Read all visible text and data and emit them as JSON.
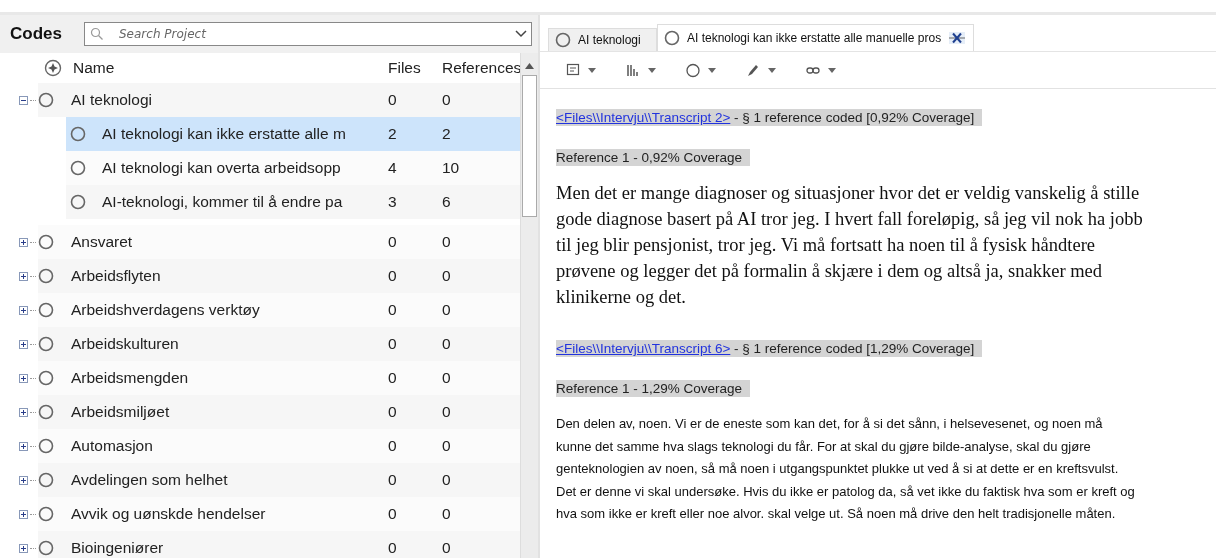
{
  "codes_panel": {
    "title": "Codes",
    "search": {
      "placeholder": "Search Project"
    },
    "columns": [
      "Name",
      "Files",
      "References"
    ],
    "rows": [
      {
        "name": "AI teknologi",
        "files": "0",
        "references": "0",
        "expanded": true,
        "selected": false,
        "children": [
          {
            "name": "AI teknologi kan ikke erstatte alle m",
            "files": "2",
            "references": "2",
            "selected": true
          },
          {
            "name": "AI teknologi kan overta arbeidsopp",
            "files": "4",
            "references": "10",
            "selected": false
          },
          {
            "name": "AI-teknologi, kommer til å endre pa",
            "files": "3",
            "references": "6",
            "selected": false
          }
        ]
      },
      {
        "name": "Ansvaret",
        "files": "0",
        "references": "0",
        "expanded": false,
        "selected": false
      },
      {
        "name": "Arbeidsflyten",
        "files": "0",
        "references": "0",
        "expanded": false,
        "selected": false
      },
      {
        "name": "Arbeidshverdagens verktøy",
        "files": "0",
        "references": "0",
        "expanded": false,
        "selected": false
      },
      {
        "name": "Arbeidskulturen",
        "files": "0",
        "references": "0",
        "expanded": false,
        "selected": false
      },
      {
        "name": "Arbeidsmengden",
        "files": "0",
        "references": "0",
        "expanded": false,
        "selected": false
      },
      {
        "name": "Arbeidsmiljøet",
        "files": "0",
        "references": "0",
        "expanded": false,
        "selected": false
      },
      {
        "name": "Automasjon",
        "files": "0",
        "references": "0",
        "expanded": false,
        "selected": false
      },
      {
        "name": "Avdelingen som helhet",
        "files": "0",
        "references": "0",
        "expanded": false,
        "selected": false
      },
      {
        "name": "Avvik og uønskde hendelser",
        "files": "0",
        "references": "0",
        "expanded": false,
        "selected": false
      },
      {
        "name": "Bioingeniører",
        "files": "0",
        "references": "0",
        "expanded": false,
        "selected": false
      }
    ]
  },
  "tabs": [
    {
      "label": "AI teknologi",
      "selected": false
    },
    {
      "label": "AI teknologi kan ikke erstatte alle manuelle pros",
      "selected": true
    }
  ],
  "references": [
    {
      "link": "<Files\\\\Intervju\\\\Transcript 2>",
      "summary": " - § 1 reference coded  [0,92% Coverage]",
      "reference": "Reference 1 - 0,92% Coverage",
      "kind": "serif",
      "lines": [
        "Men det er mange diagnoser og situasjoner hvor det er veldig vanskelig å stille",
        "gode diagnose basert på AI tror jeg.  I hvert fall foreløpig, så jeg vil nok ha jobb",
        "til jeg blir pensjonist, tror jeg. Vi må fortsatt ha noen til å fysisk håndtere",
        "prøvene og legger det på formalin å skjære i dem og altså ja, snakker med",
        "klinikerne og det."
      ]
    },
    {
      "link": "<Files\\\\Intervju\\\\Transcript 6>",
      "summary": " - § 1 reference coded  [1,29% Coverage]",
      "reference": "Reference 1 - 1,29% Coverage",
      "kind": "sans",
      "lines": [
        "Den delen av, noen. Vi er de eneste som kan det, for å si det sånn, i helsevesenet, og noen må",
        "kunne det samme hva slags teknologi du får. For at skal du gjøre bilde-analyse, skal du gjøre",
        "genteknologien av noen, så må noen i utgangspunktet plukke ut ved å si at dette er en kreftsvulst.",
        "Det er denne vi skal undersøke. Hvis du ikke er patolog da, så vet ikke du faktisk hva som er kreft og",
        "hva som ikke er kreft eller noe alvor. skal velge ut. Så noen må drive den helt tradisjonelle måten."
      ]
    }
  ]
}
